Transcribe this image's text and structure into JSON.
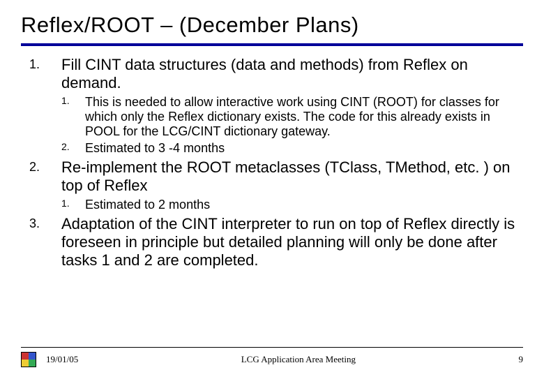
{
  "title": "Reflex/ROOT – (December Plans)",
  "items": [
    {
      "text": "Fill CINT data structures (data and methods) from Reflex on demand.",
      "sub": [
        "This is needed to allow interactive work using CINT (ROOT) for classes for which only the Reflex dictionary exists. The code for this already exists in POOL for the LCG/CINT dictionary gateway.",
        "Estimated to 3 -4 months"
      ]
    },
    {
      "text": "Re-implement the ROOT metaclasses (TClass, TMethod, etc. ) on top of Reflex",
      "sub": [
        "Estimated to 2 months"
      ]
    },
    {
      "text": "Adaptation of the CINT interpreter to run on top of Reflex directly is foreseen in principle but detailed planning will only be done after tasks 1 and 2 are completed.",
      "sub": []
    }
  ],
  "footer": {
    "date": "19/01/05",
    "center": "LCG Application Area Meeting",
    "page": "9"
  }
}
